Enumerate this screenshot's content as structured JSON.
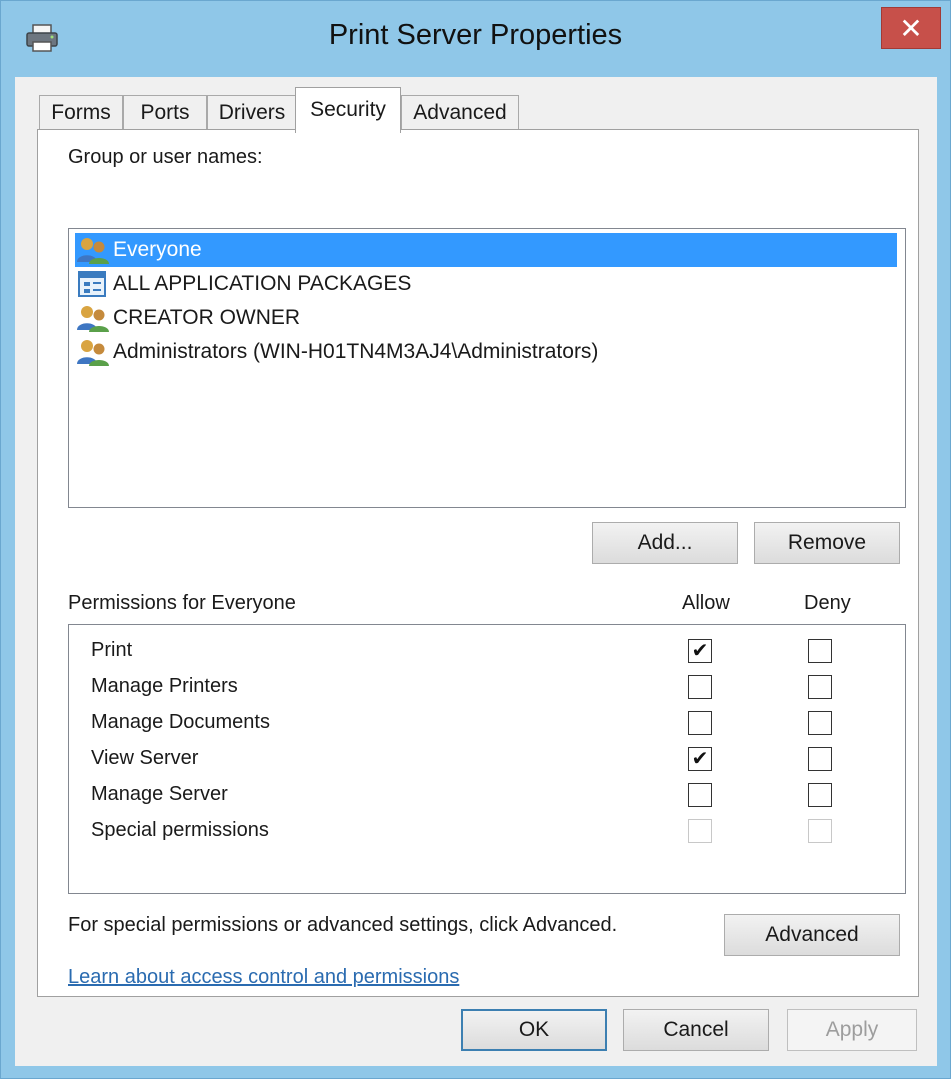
{
  "window": {
    "title": "Print Server Properties",
    "close_glyph": "✕"
  },
  "tabs": [
    {
      "label": "Forms",
      "active": false
    },
    {
      "label": "Ports",
      "active": false
    },
    {
      "label": "Drivers",
      "active": false
    },
    {
      "label": "Security",
      "active": true
    },
    {
      "label": "Advanced",
      "active": false
    }
  ],
  "security": {
    "group_label": "Group or user names:",
    "users": [
      {
        "name": "Everyone",
        "icon": "group-users-icon",
        "selected": true
      },
      {
        "name": "ALL APPLICATION PACKAGES",
        "icon": "app-packages-icon",
        "selected": false
      },
      {
        "name": "CREATOR OWNER",
        "icon": "group-users-icon",
        "selected": false
      },
      {
        "name": "Administrators (WIN-H01TN4M3AJ4\\Administrators)",
        "icon": "group-users-icon",
        "selected": false
      }
    ],
    "add_button": "Add...",
    "remove_button": "Remove",
    "permissions_label": "Permissions for Everyone",
    "allow_header": "Allow",
    "deny_header": "Deny",
    "permissions": [
      {
        "name": "Print",
        "allow": true,
        "deny": false,
        "disabled": false
      },
      {
        "name": "Manage Printers",
        "allow": false,
        "deny": false,
        "disabled": false
      },
      {
        "name": "Manage Documents",
        "allow": false,
        "deny": false,
        "disabled": false
      },
      {
        "name": "View Server",
        "allow": true,
        "deny": false,
        "disabled": false
      },
      {
        "name": "Manage Server",
        "allow": false,
        "deny": false,
        "disabled": false
      },
      {
        "name": "Special permissions",
        "allow": false,
        "deny": false,
        "disabled": true
      }
    ],
    "advanced_hint": "For special permissions or advanced settings, click Advanced.",
    "advanced_button": "Advanced",
    "learn_link": "Learn about access control and permissions"
  },
  "footer": {
    "ok": "OK",
    "cancel": "Cancel",
    "apply": "Apply"
  },
  "colors": {
    "titlebar": "#8fc7e8",
    "close": "#c7504a",
    "selection": "#3399ff",
    "link": "#2a6bb0"
  }
}
